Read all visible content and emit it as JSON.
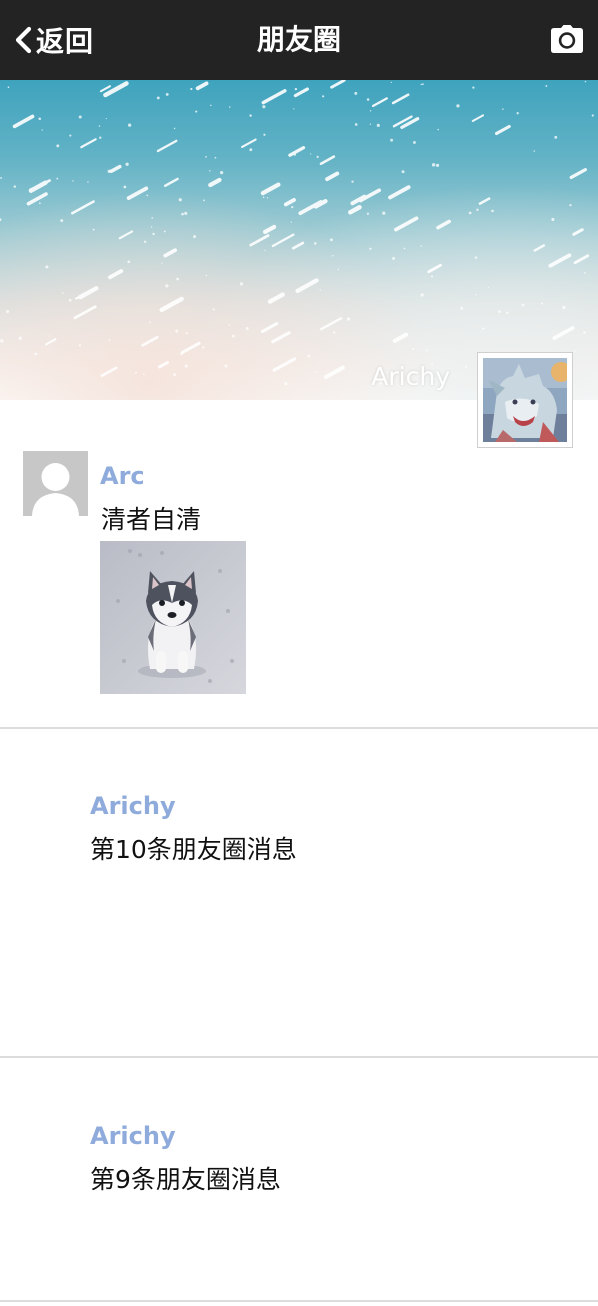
{
  "nav": {
    "back_label": "返回",
    "title": "朋友圈",
    "back_icon": "chevron-left-icon",
    "camera_icon": "camera-icon"
  },
  "cover": {
    "user_name": "Arichy"
  },
  "posts": [
    {
      "author": "Arc",
      "text": "清者自清",
      "has_photo": true,
      "photo_subject": "husky puppy"
    },
    {
      "author": "Arichy",
      "text": "第10条朋友圈消息"
    },
    {
      "author": "Arichy",
      "text": "第9条朋友圈消息"
    }
  ],
  "colors": {
    "nav_bg": "#232323",
    "author_name": "#8fabdb",
    "divider": "#dcdcdc",
    "default_avatar": "#c7c7c7"
  }
}
